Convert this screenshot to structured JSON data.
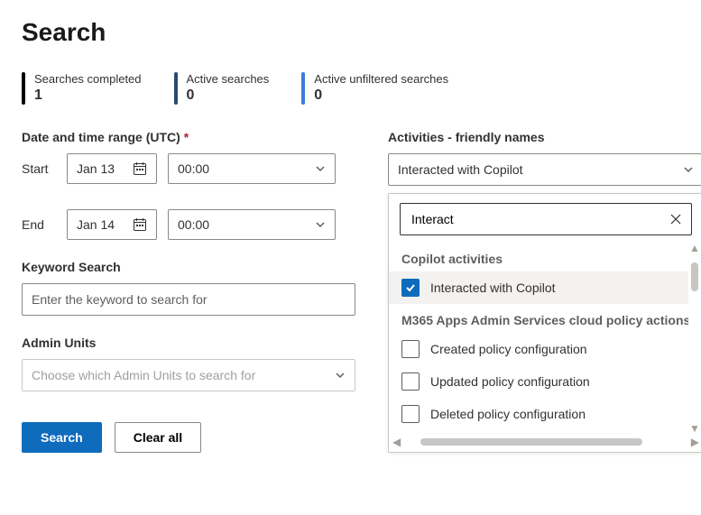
{
  "page": {
    "title": "Search"
  },
  "stats": {
    "completed_label": "Searches completed",
    "completed_value": "1",
    "active_label": "Active searches",
    "active_value": "0",
    "unfiltered_label": "Active unfiltered searches",
    "unfiltered_value": "0"
  },
  "labels": {
    "date_range": "Date and time range (UTC)",
    "required_marker": "*",
    "start": "Start",
    "end": "End",
    "keyword": "Keyword Search",
    "keyword_placeholder": "Enter the keyword to search for",
    "admin_units": "Admin Units",
    "admin_placeholder": "Choose which Admin Units to search for",
    "activities": "Activities - friendly names"
  },
  "datetime": {
    "start_date": "Jan 13",
    "start_time": "00:00",
    "end_date": "Jan 14",
    "end_time": "00:00"
  },
  "activities": {
    "selected_value": "Interacted with Copilot",
    "search_value": "Interact",
    "groups": [
      {
        "title": "Copilot activities",
        "items": [
          {
            "label": "Interacted with Copilot",
            "checked": true
          }
        ]
      },
      {
        "title": "M365 Apps Admin Services cloud policy actions",
        "items": [
          {
            "label": "Created policy configuration",
            "checked": false
          },
          {
            "label": "Updated policy configuration",
            "checked": false
          },
          {
            "label": "Deleted policy configuration",
            "checked": false
          }
        ]
      }
    ]
  },
  "buttons": {
    "search": "Search",
    "clear": "Clear all"
  }
}
